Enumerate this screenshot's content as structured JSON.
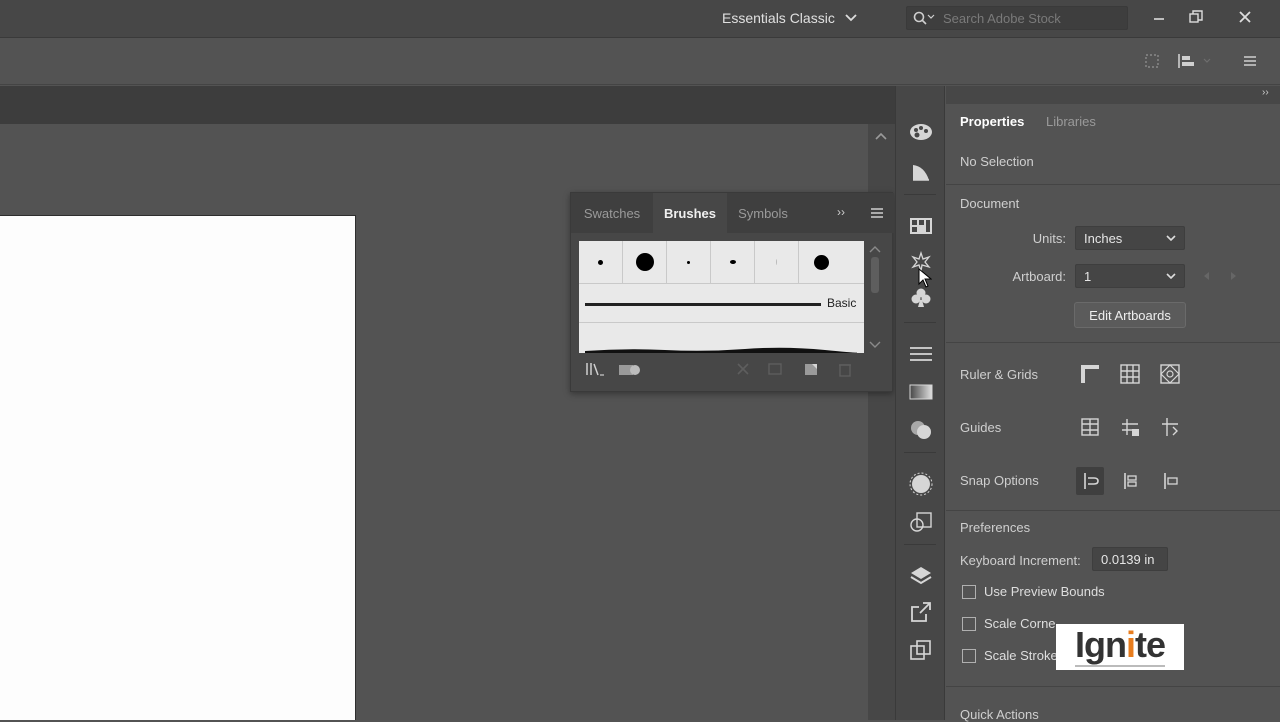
{
  "topbar": {
    "workspace": "Essentials Classic",
    "search_placeholder": "Search Adobe Stock"
  },
  "brushes_panel": {
    "tabs": [
      "Swatches",
      "Brushes",
      "Symbols"
    ],
    "selected_tab": "Brushes",
    "basic_label": "Basic"
  },
  "properties": {
    "tabs": [
      "Properties",
      "Libraries"
    ],
    "selected_tab": "Properties",
    "selection_status": "No Selection",
    "document_title": "Document",
    "units_label": "Units:",
    "units_value": "Inches",
    "artboard_label": "Artboard:",
    "artboard_value": "1",
    "edit_artboards": "Edit Artboards",
    "ruler_grids": "Ruler & Grids",
    "guides": "Guides",
    "snap_options": "Snap Options",
    "preferences": "Preferences",
    "keyboard_increment_label": "Keyboard Increment:",
    "keyboard_increment_value": "0.0139 in",
    "use_preview_bounds": "Use Preview Bounds",
    "scale_corners": "Scale Corne",
    "scale_strokes": "Scale Stroke",
    "quick_actions": "Quick Actions"
  },
  "watermark": {
    "text": "Ignite"
  }
}
